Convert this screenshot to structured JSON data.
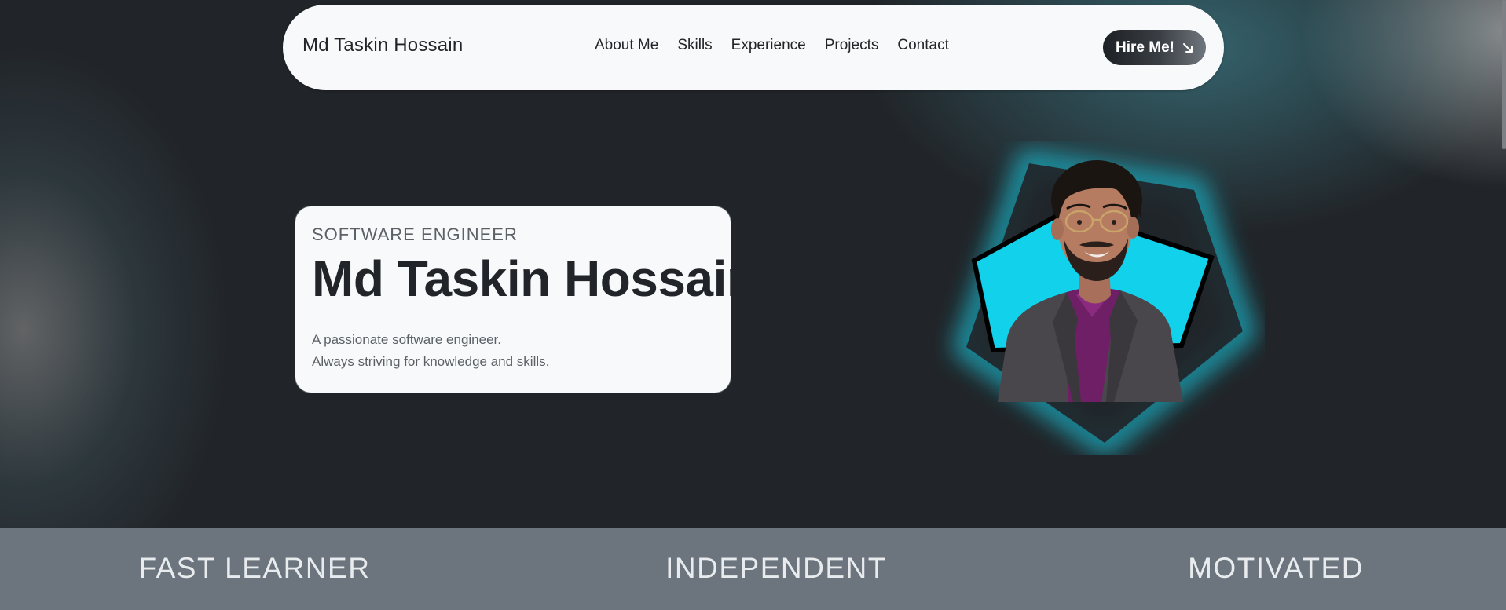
{
  "nav": {
    "brand": "Md Taskin Hossain",
    "links": [
      "About Me",
      "Skills",
      "Experience",
      "Projects",
      "Contact"
    ],
    "cta_label": "Hire Me!",
    "cta_icon": "arrow-down-right-icon"
  },
  "hero": {
    "role": "SOFTWARE ENGINEER",
    "name": "Md Taskin Hossain",
    "description_lines": [
      "A passionate software engineer.",
      "Always striving for knowledge and skills."
    ]
  },
  "portrait": {
    "frame_shape": "pentagon",
    "frame_fill": "#12d1ea",
    "glow_color": "#1aa3b5",
    "outline_color": "#000000"
  },
  "traits": [
    "FAST LEARNER",
    "INDEPENDENT",
    "MOTIVATED"
  ],
  "colors": {
    "page_background": "#212529",
    "card_background": "#f8f9fa",
    "strip_background": "#6c757d",
    "accent_cyan": "#12d1ea"
  }
}
